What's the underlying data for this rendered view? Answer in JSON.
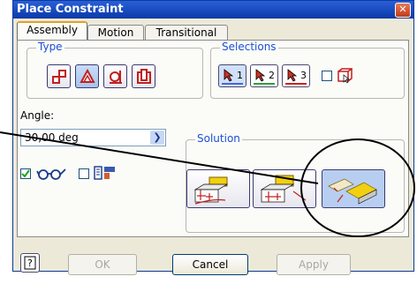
{
  "window": {
    "title": "Place Constraint",
    "close_icon": "close-icon"
  },
  "tabs": [
    {
      "label": "Assembly",
      "active": true
    },
    {
      "label": "Motion",
      "active": false
    },
    {
      "label": "Transitional",
      "active": false
    }
  ],
  "type_group": {
    "label": "Type",
    "buttons": [
      {
        "icon": "mate-constraint-icon",
        "selected": false
      },
      {
        "icon": "angle-constraint-icon",
        "selected": true
      },
      {
        "icon": "tangent-constraint-icon",
        "selected": false
      },
      {
        "icon": "insert-constraint-icon",
        "selected": false
      }
    ]
  },
  "selections_group": {
    "label": "Selections",
    "buttons": [
      {
        "number": "1",
        "color": "#4a6ad8",
        "selected": true
      },
      {
        "number": "2",
        "color": "#30a040",
        "selected": false
      },
      {
        "number": "3",
        "color": "#d02020",
        "selected": false
      }
    ],
    "pick_part_first_checked": false
  },
  "angle": {
    "label": "Angle:",
    "value": "30,00 deg"
  },
  "show_preview": {
    "checked": true,
    "icon": "glasses-icon"
  },
  "predict_offset": {
    "checked": false,
    "icon": "offset-predict-icon"
  },
  "solution_group": {
    "label": "Solution",
    "buttons": [
      {
        "icon": "directed-angle-icon",
        "selected": false
      },
      {
        "icon": "undirected-angle-icon",
        "selected": false
      },
      {
        "icon": "explicit-reference-vector-icon",
        "selected": true
      }
    ]
  },
  "buttons": {
    "ok": "OK",
    "cancel": "Cancel",
    "apply": "Apply"
  }
}
